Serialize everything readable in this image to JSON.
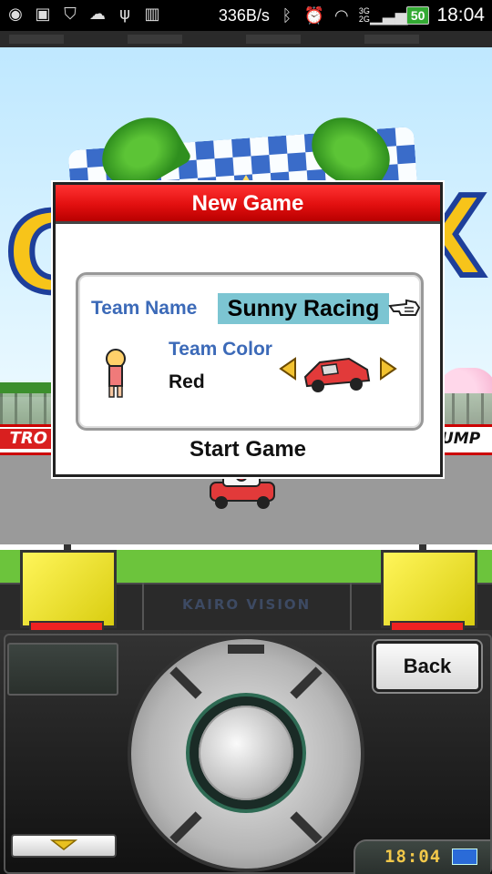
{
  "status_bar": {
    "net_speed": "336B/s",
    "network_label": "3G 2G",
    "battery": "50",
    "time": "18:04",
    "icons": [
      "game-icon",
      "gallery-icon",
      "shield-icon",
      "cloud-icon",
      "usb-icon",
      "signal-bars-icon",
      "bluetooth-icon",
      "alarm-icon",
      "wifi-icon",
      "mobile-signal-icon",
      "battery-icon"
    ]
  },
  "scene": {
    "banner_left": "TRO",
    "banner_right": "UMP"
  },
  "dialog": {
    "title": "New Game",
    "team_name_label": "Team Name",
    "team_name_value": "Sunny Racing",
    "team_color_label": "Team Color",
    "team_color_value": "Red",
    "start_label": "Start Game"
  },
  "device": {
    "brand": "KAIRO VISION",
    "back_label": "Back",
    "clock": "18:04"
  },
  "colors": {
    "dialog_header": "#e20f0f",
    "label_blue": "#3c6ab8",
    "name_field_bg": "#7cc5d2",
    "kart_red": "#e23a3a"
  }
}
